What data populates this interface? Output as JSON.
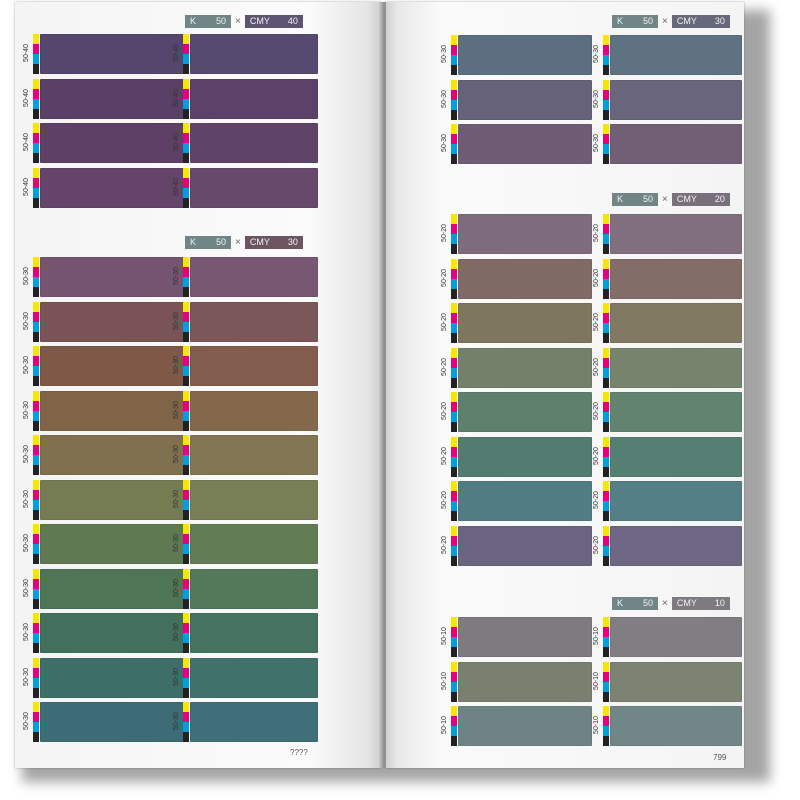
{
  "left_page": {
    "page_number": "????",
    "sections": [
      {
        "k_label": "K",
        "k_value": "50",
        "times": "×",
        "cmy_label": "CMY",
        "cmy_value": "40",
        "cmy_color": "#5c5470",
        "rows": [
          {
            "codes": [
              "50-40",
              "50-40"
            ],
            "colors": [
              "#55466e",
              "#574a70"
            ]
          },
          {
            "codes": [
              "50-40",
              "50-40"
            ],
            "colors": [
              "#5a3f66",
              "#5c4268"
            ]
          },
          {
            "codes": [
              "50-40",
              "50-40"
            ],
            "colors": [
              "#5e4066",
              "#604468"
            ]
          },
          {
            "codes": [
              "50-40",
              "50-40"
            ],
            "colors": [
              "#644569",
              "#67496c"
            ]
          }
        ]
      },
      {
        "k_label": "K",
        "k_value": "50",
        "times": "×",
        "cmy_label": "CMY",
        "cmy_value": "30",
        "cmy_color": "#6b5560",
        "rows": [
          {
            "codes": [
              "50-30",
              "50-30"
            ],
            "colors": [
              "#745470",
              "#775873"
            ]
          },
          {
            "codes": [
              "50-30",
              "50-30"
            ],
            "colors": [
              "#7a5356",
              "#7c5759"
            ]
          },
          {
            "codes": [
              "50-30",
              "50-30"
            ],
            "colors": [
              "#7f5848",
              "#825c4c"
            ]
          },
          {
            "codes": [
              "50-30",
              "50-30"
            ],
            "colors": [
              "#806448",
              "#83684c"
            ]
          },
          {
            "codes": [
              "50-30",
              "50-30"
            ],
            "colors": [
              "#7f7150",
              "#827554"
            ]
          },
          {
            "codes": [
              "50-30",
              "50-30"
            ],
            "colors": [
              "#757c52",
              "#787f56"
            ]
          },
          {
            "codes": [
              "50-30",
              "50-30"
            ],
            "colors": [
              "#5f7a52",
              "#627d56"
            ]
          },
          {
            "codes": [
              "50-30",
              "50-30"
            ],
            "colors": [
              "#4e7656",
              "#51795a"
            ]
          },
          {
            "codes": [
              "50-30",
              "50-30"
            ],
            "colors": [
              "#42705c",
              "#457360"
            ]
          },
          {
            "codes": [
              "50-30",
              "50-30"
            ],
            "colors": [
              "#3d6e68",
              "#40716b"
            ]
          },
          {
            "codes": [
              "50-30",
              "50-30"
            ],
            "colors": [
              "#3e6c76",
              "#416f79"
            ]
          }
        ]
      }
    ]
  },
  "right_page": {
    "page_number": "799",
    "sections": [
      {
        "k_label": "K",
        "k_value": "50",
        "times": "×",
        "cmy_label": "CMY",
        "cmy_value": "30",
        "cmy_color": "#67687a",
        "rows": [
          {
            "codes": [
              "50-30",
              "50-30"
            ],
            "colors": [
              "#5c6f80",
              "#5f7282"
            ]
          },
          {
            "codes": [
              "50-30",
              "50-30"
            ],
            "colors": [
              "#65627a",
              "#68657c"
            ]
          },
          {
            "codes": [
              "50-30",
              "50-30"
            ],
            "colors": [
              "#6e5c74",
              "#715f76"
            ]
          }
        ]
      },
      {
        "k_label": "K",
        "k_value": "50",
        "times": "×",
        "cmy_label": "CMY",
        "cmy_value": "20",
        "cmy_color": "#7a6f7c",
        "rows": [
          {
            "codes": [
              "50-20",
              "50-20"
            ],
            "colors": [
              "#7e6c7e",
              "#816f80"
            ]
          },
          {
            "codes": [
              "50-20",
              "50-20"
            ],
            "colors": [
              "#7f6a66",
              "#826d69"
            ]
          },
          {
            "codes": [
              "50-20",
              "50-20"
            ],
            "colors": [
              "#7e765e",
              "#817961"
            ]
          },
          {
            "codes": [
              "50-20",
              "50-20"
            ],
            "colors": [
              "#73806a",
              "#76836d"
            ]
          },
          {
            "codes": [
              "50-20",
              "50-20"
            ],
            "colors": [
              "#5f806c",
              "#62836f"
            ]
          },
          {
            "codes": [
              "50-20",
              "50-20"
            ],
            "colors": [
              "#527c70",
              "#557f73"
            ]
          },
          {
            "codes": [
              "50-20",
              "50-20"
            ],
            "colors": [
              "#527c84",
              "#557f87"
            ]
          },
          {
            "codes": [
              "50-20",
              "50-20"
            ],
            "colors": [
              "#6a6480",
              "#6d6783"
            ]
          }
        ]
      },
      {
        "k_label": "K",
        "k_value": "50",
        "times": "×",
        "cmy_label": "CMY",
        "cmy_value": "10",
        "cmy_color": "#7d7a80",
        "rows": [
          {
            "codes": [
              "50-10",
              "50-10"
            ],
            "colors": [
              "#7d7b80",
              "#807e83"
            ]
          },
          {
            "codes": [
              "50-10",
              "50-10"
            ],
            "colors": [
              "#79806f",
              "#7c8372"
            ]
          },
          {
            "codes": [
              "50-10",
              "50-10"
            ],
            "colors": [
              "#6e8484",
              "#718787"
            ]
          }
        ]
      }
    ]
  }
}
